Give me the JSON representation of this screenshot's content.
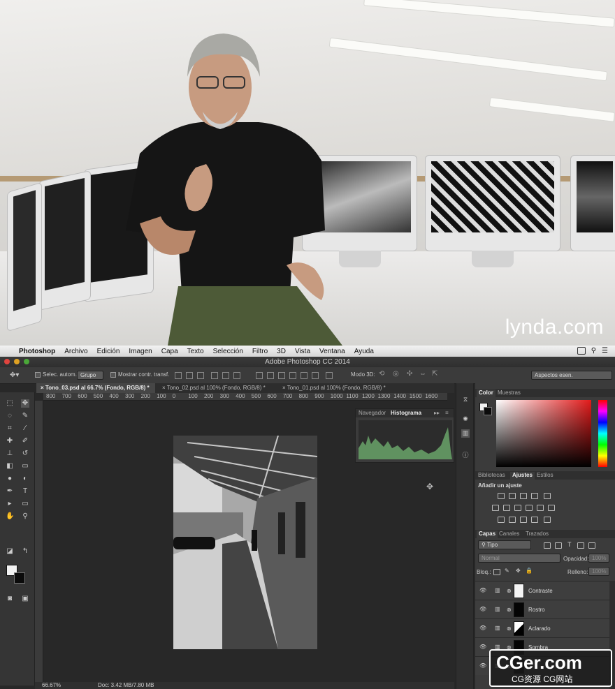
{
  "watermark_lynda": "lynda.com",
  "menubar": {
    "items": [
      "Photoshop",
      "Archivo",
      "Edición",
      "Imagen",
      "Capa",
      "Texto",
      "Selección",
      "Filtro",
      "3D",
      "Vista",
      "Ventana",
      "Ayuda"
    ]
  },
  "window": {
    "title": "Adobe Photoshop CC 2014"
  },
  "options_bar": {
    "auto_select_label": "Selec. autom.:",
    "auto_select_value": "Grupo",
    "show_transform_label": "Mostrar contr. transf.",
    "mode3d_label": "Modo 3D:",
    "workspace": "Aspectos esen."
  },
  "tabs": [
    {
      "label": "Tono_03.psd al 66.7% (Fondo, RGB/8) *",
      "active": true
    },
    {
      "label": "Tono_02.psd al 100% (Fondo, RGB/8) *",
      "active": false
    },
    {
      "label": "Tono_01.psd al 100% (Fondo, RGB/8) *",
      "active": false
    }
  ],
  "ruler_ticks": [
    "800",
    "700",
    "600",
    "500",
    "400",
    "300",
    "200",
    "100",
    "0",
    "100",
    "200",
    "300",
    "400",
    "500",
    "600",
    "700",
    "800",
    "900",
    "1000",
    "1100",
    "1200",
    "1300",
    "1400",
    "1500",
    "1600"
  ],
  "status": {
    "zoom": "66.67%",
    "doc": "Doc: 3.42 MB/7.80 MB"
  },
  "histogram_panel": {
    "tabs": [
      "Navegador",
      "Histograma"
    ],
    "active": "Histograma"
  },
  "color_panel": {
    "tabs": [
      "Color",
      "Muestras"
    ],
    "active": "Color"
  },
  "adjust_panel": {
    "tabs": [
      "Bibliotecas",
      "Ajustes",
      "Estilos"
    ],
    "active": "Ajustes",
    "heading": "Añadir un ajuste"
  },
  "layers_panel": {
    "tabs": [
      "Capas",
      "Canales",
      "Trazados"
    ],
    "active": "Capas",
    "filter": "Tipo",
    "blend_mode": "Normal",
    "opacity_label": "Opacidad:",
    "opacity_value": "100%",
    "lock_label": "Bloq.:",
    "fill_label": "Relleno:",
    "fill_value": "100%",
    "layers": [
      {
        "name": "Contraste",
        "mask": "white"
      },
      {
        "name": "Rostro",
        "mask": "black"
      },
      {
        "name": "Aclarado",
        "mask": "split"
      },
      {
        "name": "Sombra",
        "mask": "black"
      },
      {
        "name": "",
        "mask": "black"
      }
    ]
  },
  "watermark_cger": {
    "big": "CGer.com",
    "sub": "CG资源  CG网站"
  }
}
